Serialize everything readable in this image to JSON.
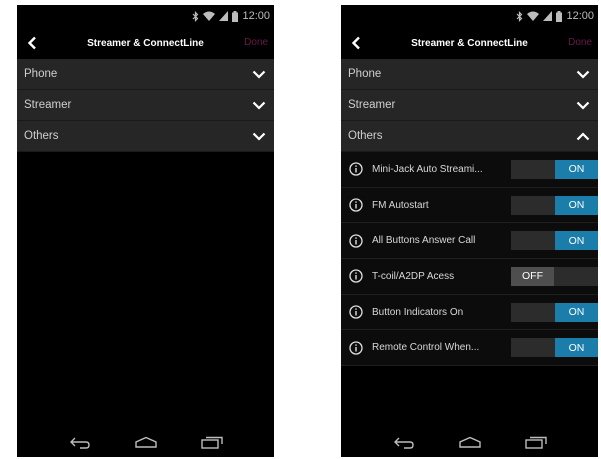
{
  "status": {
    "time": "12:00",
    "icons": [
      "bluetooth-icon",
      "wifi-icon",
      "signal-icon",
      "battery-icon"
    ]
  },
  "header": {
    "title": "Streamer & ConnectLine",
    "done_label": "Done",
    "back_icon": "chevron-left-icon"
  },
  "sections": [
    {
      "label": "Phone",
      "expanded": false
    },
    {
      "label": "Streamer",
      "expanded": false
    },
    {
      "label": "Others",
      "expanded": true
    }
  ],
  "others_settings": [
    {
      "label": "Mini-Jack Auto Streami...",
      "state": "ON"
    },
    {
      "label": "FM Autostart",
      "state": "ON"
    },
    {
      "label": "All Buttons Answer Call",
      "state": "ON"
    },
    {
      "label": "T-coil/A2DP Acess",
      "state": "OFF"
    },
    {
      "label": "Button Indicators On",
      "state": "ON"
    },
    {
      "label": "Remote Control When...",
      "state": "ON"
    }
  ],
  "nav": {
    "icons": [
      "back-nav-icon",
      "home-nav-icon",
      "recent-apps-icon"
    ]
  },
  "colors": {
    "accent": "#1b7da9",
    "done": "#6b1846",
    "section_bg": "#262626",
    "background": "#000000",
    "toggle_off": "#4e4e4e"
  }
}
